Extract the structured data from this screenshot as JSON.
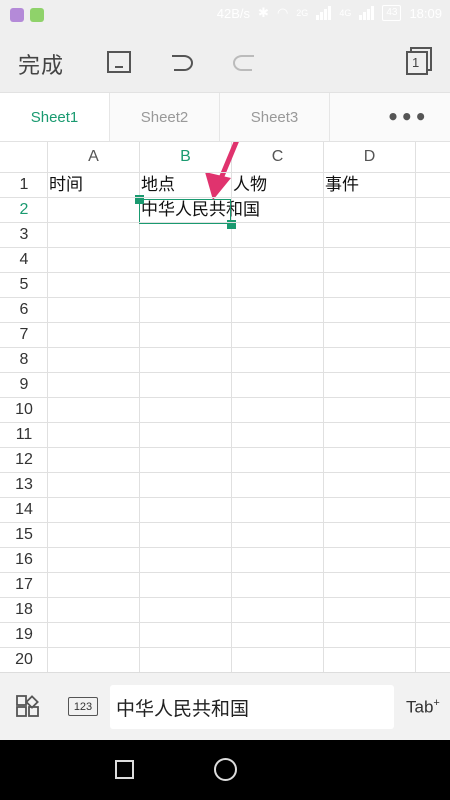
{
  "status_bar": {
    "network_speed": "42B/s",
    "net_a": "2G",
    "net_b": "4G",
    "battery": "43",
    "time": "18:09"
  },
  "toolbar": {
    "done_label": "完成",
    "window_count": "1"
  },
  "tabs": [
    {
      "label": "Sheet1",
      "active": true
    },
    {
      "label": "Sheet2",
      "active": false
    },
    {
      "label": "Sheet3",
      "active": false
    }
  ],
  "more_label": "•••",
  "columns": [
    "A",
    "B",
    "C",
    "D"
  ],
  "selected_column": "B",
  "rows": [
    "1",
    "2",
    "3",
    "4",
    "5",
    "6",
    "7",
    "8",
    "9",
    "10",
    "11",
    "12",
    "13",
    "14",
    "15",
    "16",
    "17",
    "18",
    "19",
    "20"
  ],
  "selected_row": "2",
  "cells": {
    "A1": "时间",
    "B1": "地点",
    "C1": "人物",
    "D1": "事件",
    "B2": "中华人民共和国"
  },
  "edit_bar": {
    "keyboard_mode": "123",
    "input_value": "中华人民共和国",
    "tab_key": "Tab"
  },
  "colors": {
    "accent": "#1a9a70",
    "annotation_arrow": "#e0336e"
  }
}
